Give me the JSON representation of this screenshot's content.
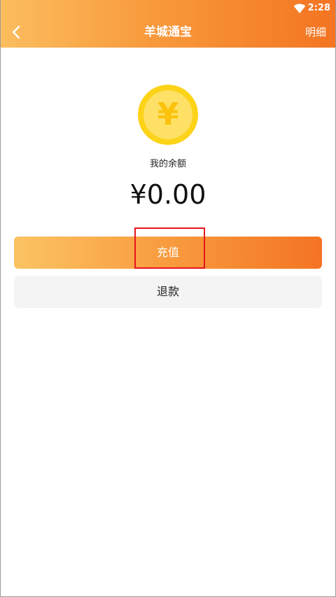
{
  "status_bar": {
    "time": "2:28",
    "wifi_icon": "wifi-icon"
  },
  "nav": {
    "back_icon": "chevron-left-icon",
    "title": "羊城通宝",
    "detail_label": "明细"
  },
  "wallet": {
    "coin_icon": "yuan-coin-icon",
    "coin_symbol": "¥",
    "balance_label": "我的余额",
    "balance_amount": "¥0.00"
  },
  "actions": {
    "recharge_label": "充值",
    "refund_label": "退款"
  },
  "colors": {
    "header_gradient_start": "#fbbd5e",
    "header_gradient_end": "#f47422",
    "coin_outer": "#fcd316",
    "coin_inner": "#fde065",
    "refund_bg": "#f4f4f4",
    "highlight": "#e8151c"
  }
}
